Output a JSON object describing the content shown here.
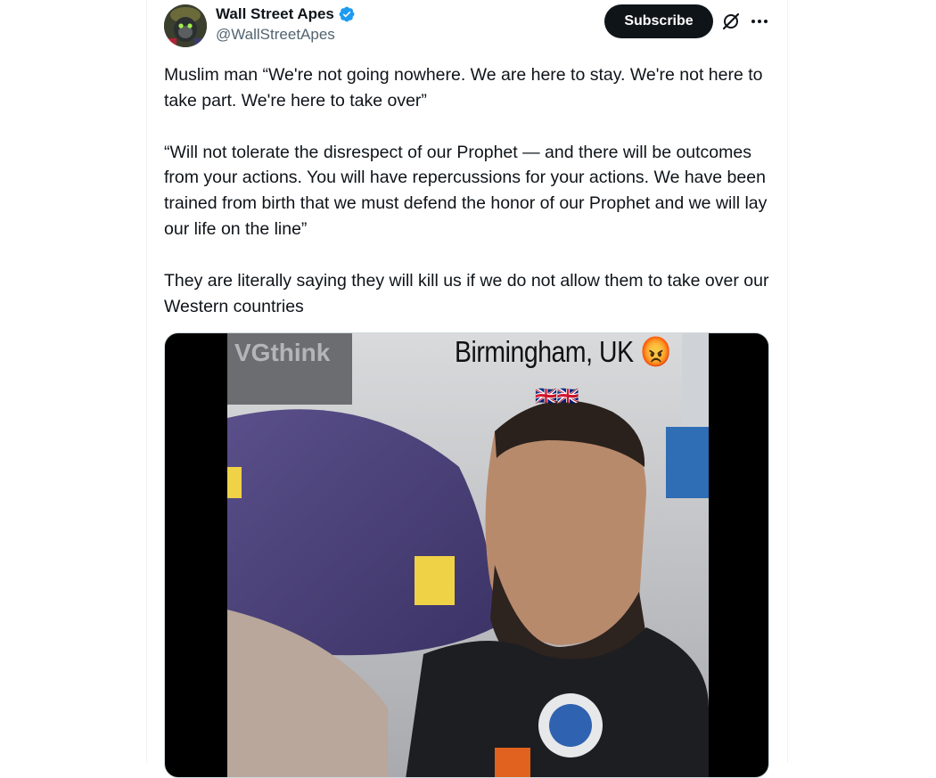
{
  "author": {
    "display_name": "Wall Street Apes",
    "handle": "@WallStreetApes",
    "verified": true,
    "avatar_icon": "gorilla-avatar-icon"
  },
  "actions": {
    "subscribe_label": "Subscribe",
    "grok_icon": "grok-icon",
    "more_icon": "more-options-icon"
  },
  "tweet": {
    "paragraphs": [
      "Muslim man “We're not going nowhere. We are here to stay. We're not here to take part. We're here to take over”",
      "“Will not tolerate the disrespect of our Prophet — and there will be outcomes from your actions. You will have repercussions for your actions. We have been trained from birth that we must defend the honor of our Prophet and we will lay our life on the line”",
      "They are literally saying they will kill us if we do not allow them to take over our Western countries"
    ]
  },
  "media": {
    "type": "video",
    "overlay_title": "Birmingham, UK 😡",
    "overlay_flags": "🇬🇧🇬🇧",
    "watermark": "VGthink"
  },
  "colors": {
    "text_primary": "#0f1419",
    "text_secondary": "#536471",
    "verified_blue": "#1d9bf0",
    "button_dark": "#0f1419",
    "border": "#eff3f4"
  }
}
